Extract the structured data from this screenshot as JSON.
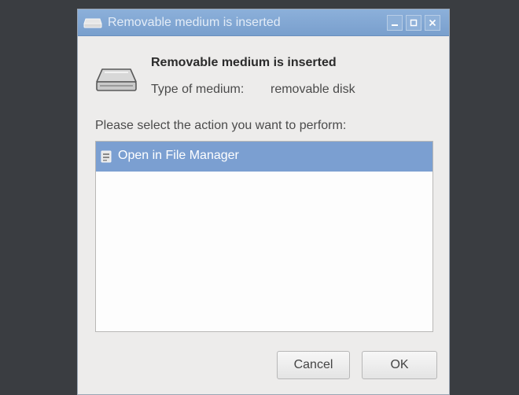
{
  "window": {
    "title": "Removable medium is inserted",
    "controls": {
      "minimize_icon": "minimize-icon",
      "maximize_icon": "maximize-icon",
      "close_icon": "close-icon"
    }
  },
  "dialog": {
    "heading": "Removable medium is inserted",
    "type_label": "Type of medium:",
    "type_value": "removable disk",
    "prompt": "Please select the action you want to perform:",
    "actions": [
      {
        "label": "Open in File Manager",
        "icon": "file-manager-icon",
        "selected": true
      }
    ],
    "cancel_label": "Cancel",
    "ok_label": "OK"
  },
  "colors": {
    "titlebar": "#7fa4d2",
    "selection": "#7b9fd1",
    "desktop": "#3a3d41",
    "window_bg": "#edeceb"
  }
}
